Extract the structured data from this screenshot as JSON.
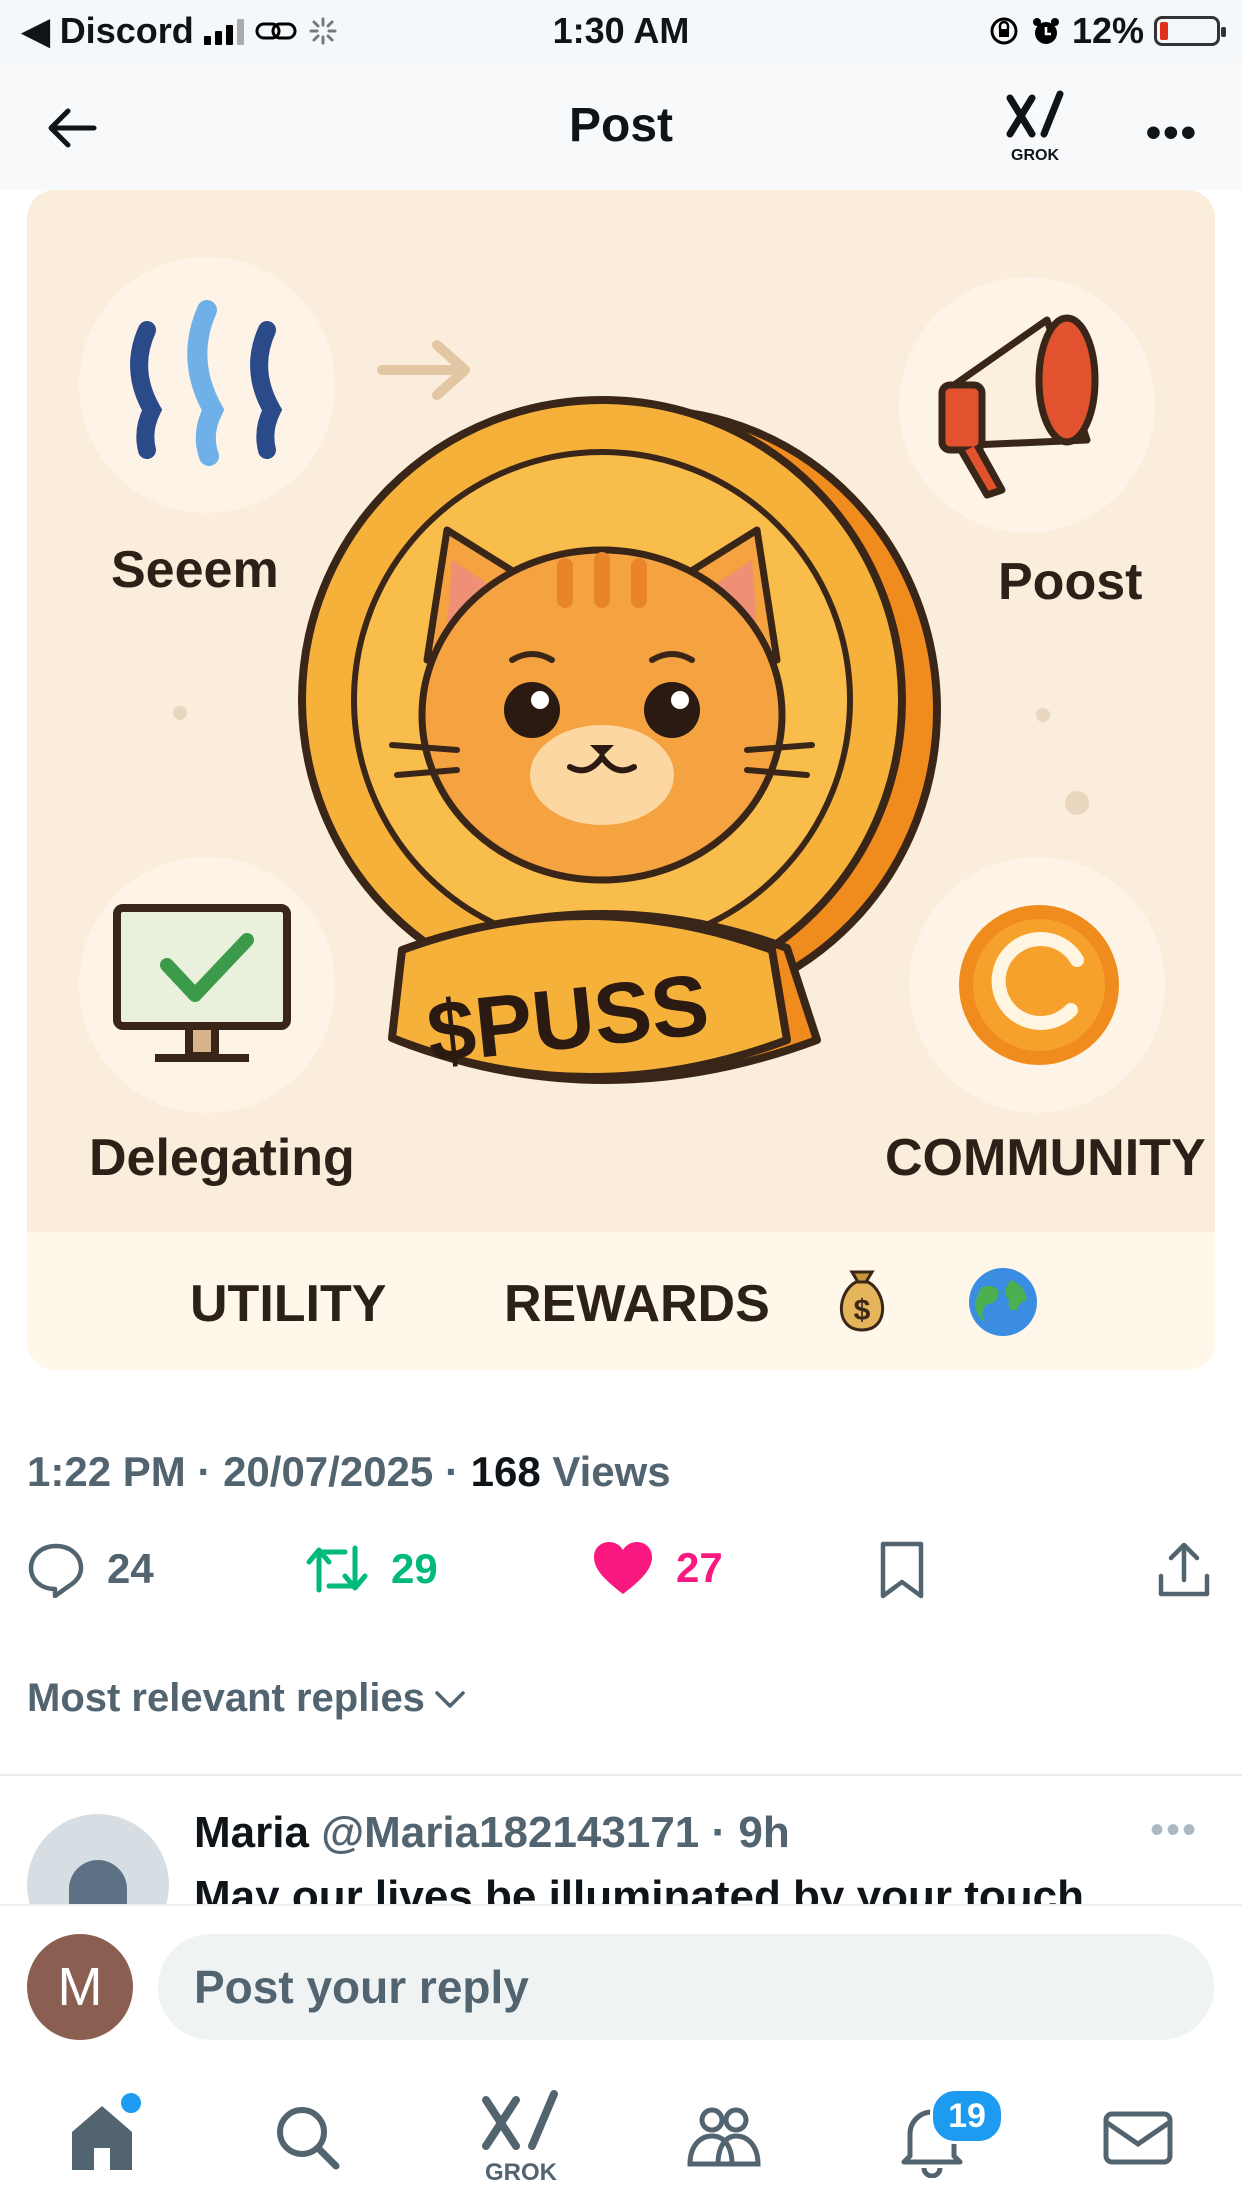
{
  "status_bar": {
    "back_app": "Discord",
    "time": "1:30 AM",
    "battery": "12%"
  },
  "header": {
    "title": "Post",
    "grok_label": "GROK",
    "more": "•••"
  },
  "post_image": {
    "labels": {
      "top_left": "Seeem",
      "top_right": "Poost",
      "coin_text": "$PUSS",
      "bottom_left": "Delegating",
      "bottom_right": "COMMUNITY"
    },
    "strip": {
      "utility": "UTILITY",
      "rewards": "REWARDS"
    },
    "icons": [
      "steem-logo-icon",
      "arrow-icon",
      "megaphone-icon",
      "cat-coin-icon",
      "monitor-check-icon",
      "community-coin-icon",
      "money-bag-icon",
      "globe-icon"
    ],
    "colors": {
      "background": "#fbeddb",
      "coin": "#f6b13a",
      "coin_outline": "#3a2618"
    }
  },
  "meta": {
    "time": "1:22 PM",
    "sep1": " · ",
    "date": "20/07/2025",
    "sep2": " · ",
    "views_count": "168",
    "views_label": " Views"
  },
  "actions": {
    "replies": "24",
    "reposts": "29",
    "likes": "27",
    "colors": {
      "repost": "#00ba7c",
      "like": "#f91880",
      "neutral": "#536471"
    }
  },
  "replies_filter": "Most relevant replies",
  "reply": {
    "name": "Maria",
    "handle": "@Maria182143171",
    "age": "· 9h",
    "text": "May our lives be illuminated by your touch",
    "more": "•••"
  },
  "composer": {
    "avatar_letter": "M",
    "placeholder": "Post your reply"
  },
  "nav": {
    "grok_label": "GROK",
    "notifications_badge": "19",
    "icons": [
      "home-icon",
      "search-icon",
      "grok-icon",
      "communities-icon",
      "bell-icon",
      "mail-icon"
    ]
  }
}
